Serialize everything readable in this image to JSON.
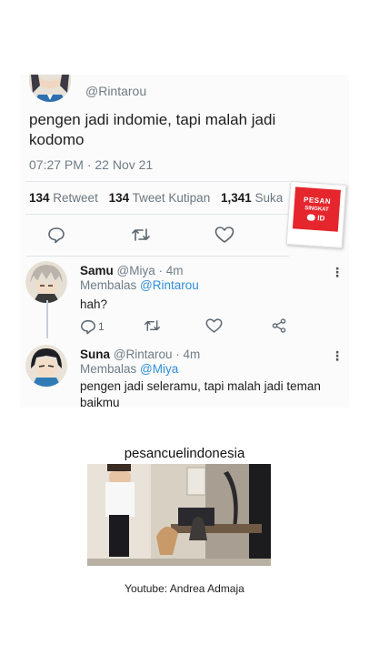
{
  "main_tweet": {
    "handle": "@Rintarou",
    "text": "pengen jadi indomie, tapi malah jadi kodomo",
    "timestamp": "07:27 PM · 22 Nov 21",
    "stats": {
      "retweets_count": "134",
      "retweets_label": "Retweet",
      "quotes_count": "134",
      "quotes_label": "Tweet Kutipan",
      "likes_count": "1,341",
      "likes_label": "Suka"
    },
    "actions": [
      "reply-icon",
      "retweet-icon",
      "like-icon"
    ]
  },
  "replies": [
    {
      "display_name": "Samu",
      "handle_time": "@Miya · 4m",
      "replying_prefix": "Membalas",
      "replying_to": "@Rintarou",
      "text": "hah?",
      "reply_count": "1",
      "actions": [
        "reply-icon",
        "retweet-icon",
        "like-icon",
        "share-icon"
      ]
    },
    {
      "display_name": "Suna",
      "handle_time": "@Rintarou · 4m",
      "replying_prefix": "Membalas",
      "replying_to": "@Miya",
      "text": "pengen jadi seleramu, tapi malah jadi teman baikmu"
    }
  ],
  "stamp": {
    "line1": "PESAN",
    "line2": "SINGKAT",
    "line3": "ID",
    "color": "#e5262c"
  },
  "more_menu_glyph": "⋮",
  "channel_title": "pesancuelindonesia",
  "credit": "Youtube: Andrea Admaja",
  "colors": {
    "mention": "#2f8fd8",
    "muted": "#707d87",
    "card_bg": "#fbfbfb"
  }
}
